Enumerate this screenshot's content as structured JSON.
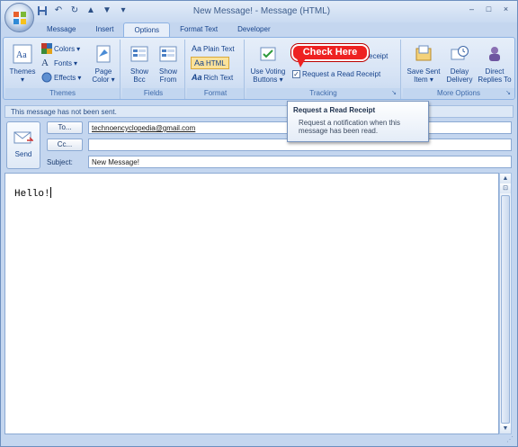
{
  "window": {
    "title": "New Message! - Message (HTML)",
    "controls": [
      "–",
      "□",
      "×"
    ]
  },
  "qat": {
    "icons": [
      "save-icon",
      "undo-icon",
      "redo-icon",
      "up-icon",
      "down-icon",
      "dropdown-icon"
    ]
  },
  "tabs": [
    {
      "label": "Message",
      "active": false
    },
    {
      "label": "Insert",
      "active": false
    },
    {
      "label": "Options",
      "active": true
    },
    {
      "label": "Format Text",
      "active": false
    },
    {
      "label": "Developer",
      "active": false
    }
  ],
  "ribbon": {
    "themes": {
      "themes_btn": "Themes",
      "colors": "Colors",
      "fonts": "Fonts",
      "effects": "Effects",
      "page_color_1": "Page",
      "page_color_2": "Color",
      "group": "Themes"
    },
    "fields": {
      "show_bcc_1": "Show",
      "show_bcc_2": "Bcc",
      "show_from_1": "Show",
      "show_from_2": "From",
      "group": "Fields"
    },
    "format": {
      "plain": "Plain Text",
      "html": "HTML",
      "rich": "Rich Text",
      "group": "Format"
    },
    "tracking": {
      "voting_1": "Use Voting",
      "voting_2": "Buttons",
      "delivery_partial": "eceipt",
      "read_receipt": "Request a Read Receipt",
      "read_receipt_checked": true,
      "group": "Tracking"
    },
    "more": {
      "save_sent_1": "Save Sent",
      "save_sent_2": "Item",
      "delay_1": "Delay",
      "delay_2": "Delivery",
      "direct_1": "Direct",
      "direct_2": "Replies To",
      "group": "More Options"
    }
  },
  "callout": {
    "text": "Check Here"
  },
  "tooltip": {
    "title": "Request a Read Receipt",
    "body": "Request a notification when this message has been read."
  },
  "infobar": {
    "text": "This message has not been sent."
  },
  "compose": {
    "send_label": "Send",
    "to_btn": "To...",
    "cc_btn": "Cc...",
    "subject_label": "Subject:",
    "to_value": "technoencyclopedia@gmail.com",
    "cc_value": "",
    "subject_value": "New Message!",
    "body": "Hello!"
  },
  "colors": {
    "accent": "#15428b",
    "callout": "#e22222",
    "ribbon_bg": "#dbe7f6"
  }
}
